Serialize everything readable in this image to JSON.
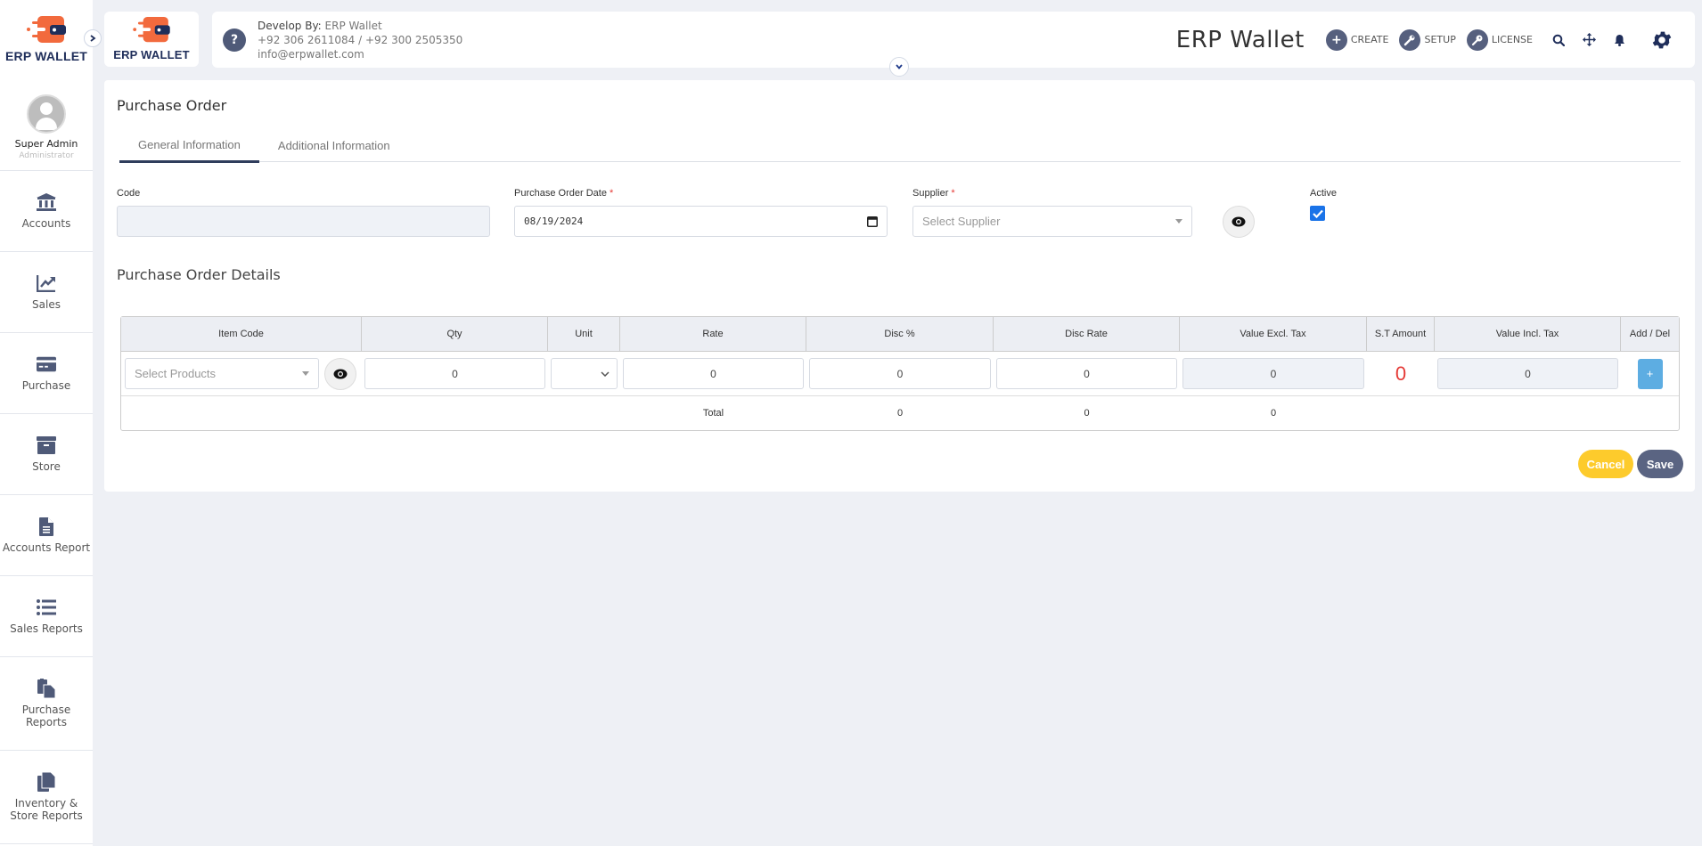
{
  "brand": {
    "logo_text_bold": "ERP",
    "logo_text": "WALLET",
    "accent": "#f26a3d",
    "navy": "#1f2e5a"
  },
  "sidebar": {
    "user": {
      "name": "Super Admin",
      "role": "Administrator"
    },
    "items": [
      {
        "label": "Accounts",
        "icon": "bank-icon"
      },
      {
        "label": "Sales",
        "icon": "chart-line-icon"
      },
      {
        "label": "Purchase",
        "icon": "credit-card-icon"
      },
      {
        "label": "Store",
        "icon": "archive-box-icon"
      },
      {
        "label": "Accounts Report",
        "icon": "file-text-icon"
      },
      {
        "label": "Sales Reports",
        "icon": "list-icon"
      },
      {
        "label": "Purchase Reports",
        "icon": "copy-files-icon"
      },
      {
        "label": "Inventory & Store Reports",
        "icon": "copy-files-icon"
      }
    ]
  },
  "header": {
    "dev_label": "Develop By:",
    "dev_name": "ERP Wallet",
    "phone1": "+92 306 2611084",
    "phone_sep": " / ",
    "phone2": "+92 300 2505350",
    "email": "info@erpwallet.com",
    "app_title": "ERP Wallet",
    "buttons": [
      {
        "label": "CREATE",
        "icon": "plus-icon"
      },
      {
        "label": "SETUP",
        "icon": "wrench-icon"
      },
      {
        "label": "LICENSE",
        "icon": "key-icon"
      }
    ],
    "icons": [
      "search-icon",
      "move-arrows-icon",
      "bell-icon",
      "gear-icon"
    ]
  },
  "page": {
    "title": "Purchase Order",
    "tabs": [
      {
        "label": "General Information",
        "active": true
      },
      {
        "label": "Additional Information",
        "active": false
      }
    ],
    "form": {
      "code_label": "Code",
      "code_value": "",
      "date_label": "Purchase Order Date",
      "date_value": "08/19/2024",
      "supplier_label": "Supplier",
      "supplier_placeholder": "Select Supplier",
      "active_label": "Active",
      "active_checked": true,
      "required_mark": "*"
    },
    "details_title": "Purchase Order Details",
    "table": {
      "columns": [
        "Item Code",
        "Qty",
        "Unit",
        "Rate",
        "Disc %",
        "Disc Rate",
        "Value Excl. Tax",
        "S.T Amount",
        "Value Incl. Tax",
        "Add / Del"
      ],
      "row": {
        "product_placeholder": "Select Products",
        "qty": "0",
        "unit": "",
        "rate": "0",
        "disc_pct": "0",
        "disc_rate": "0",
        "value_excl_tax": "0",
        "st_amount": "0",
        "value_incl_tax": "0",
        "add_label": "+"
      },
      "totals": {
        "label": "Total",
        "disc_pct": "0",
        "disc_rate": "0",
        "value_excl_tax": "0"
      }
    },
    "actions": {
      "cancel": "Cancel",
      "save": "Save"
    }
  }
}
